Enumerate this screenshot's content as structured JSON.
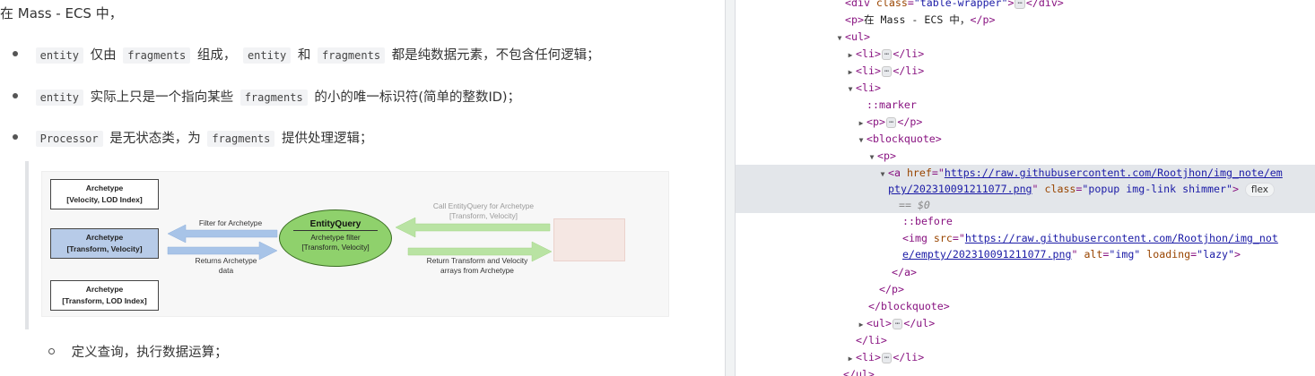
{
  "article": {
    "intro": "在 Mass - ECS 中，",
    "bullets": [
      {
        "code1": "entity",
        "t1": "仅由",
        "code2": "fragments",
        "t2": "组成，",
        "code3": "entity",
        "t3": "和",
        "code4": "fragments",
        "t4": "都是纯数据元素，不包含任何逻辑；"
      },
      {
        "code1": "entity",
        "t1": "实际上只是一个指向某些",
        "code2": "fragments",
        "t2": "的小的唯一标识符(简单的整数ID)；"
      },
      {
        "code1": "Processor",
        "t1": "是无状态类，为",
        "code2": "fragments",
        "t2": "提供处理逻辑；"
      }
    ],
    "sub_bullet": "定义查询，执行数据运算；",
    "diagram": {
      "archetypes": [
        {
          "line1": "Archetype",
          "line2": "[Velocity, LOD Index]"
        },
        {
          "line1": "Archetype",
          "line2": "[Transform, Velocity]"
        },
        {
          "line1": "Archetype",
          "line2": "[Transform, LOD Index]"
        }
      ],
      "entity_query": {
        "title": "EntityQuery",
        "sub1": "Archetype filter",
        "sub2": "[Transform, Velocity]"
      },
      "filter_label": "Filter for Archetype",
      "returns_label_1": "Returns Archetype",
      "returns_label_2": "data",
      "call_label_1": "Call EntityQuery for Archetype",
      "call_label_2": "[Transform, Velocity]",
      "return_tv_1": "Return Transform and Velocity",
      "return_tv_2": "arrays from Archetype",
      "colors": {
        "highlight": "#b7cbe8",
        "query": "#8fd16c",
        "arrow_blue": "#a8c4e8",
        "arrow_green": "#b9e3a3"
      }
    }
  },
  "devtools": {
    "lines": [
      {
        "text_div_open": "<div ",
        "attr": "class",
        "val": "\"table-wrapper\"",
        "close": "></div>"
      },
      {
        "p_text": "在 Mass - ECS 中，"
      },
      {
        "ul": "<ul>"
      },
      {
        "li": "<li>",
        "li_close": "</li>"
      },
      {
        "li": "<li>",
        "li_close": "</li>"
      },
      {
        "li": "<li>"
      },
      {
        "marker": "::marker"
      },
      {
        "p": "<p>",
        "p_close": "</p>"
      },
      {
        "bq": "<blockquote>"
      },
      {
        "p": "<p>"
      },
      {
        "a_open": "<a ",
        "href_attr": "href",
        "href_val_1": "https://raw.githubusercontent.com/Rootjhon/img_note/em",
        "href_val_2": "pty/202310091211077.png",
        "class_attr": "class",
        "class_val": "\"popup img-link shimmer\"",
        "badge": "flex",
        "eq0": "== $0"
      },
      {
        "before": "::before"
      },
      {
        "img_open": "<img ",
        "src_attr": "src",
        "src_val_1": "https://raw.githubusercontent.com/Rootjhon/img_not",
        "src_val_2": "e/empty/202310091211077.png",
        "alt_attr": "alt",
        "alt_val": "\"img\"",
        "loading_attr": "loading",
        "loading_val": "\"lazy\"",
        "end": ">"
      },
      {
        "a_close": "</a>"
      },
      {
        "p_close": "</p>"
      },
      {
        "bq_close": "</blockquote>"
      },
      {
        "ul_open": "<ul>",
        "ul_close": "</ul>"
      },
      {
        "li_close": "</li>"
      },
      {
        "li": "<li>",
        "li_close": "</li>"
      },
      {
        "ul_close": "</ul>"
      }
    ],
    "gutter_dots": "⋯"
  }
}
